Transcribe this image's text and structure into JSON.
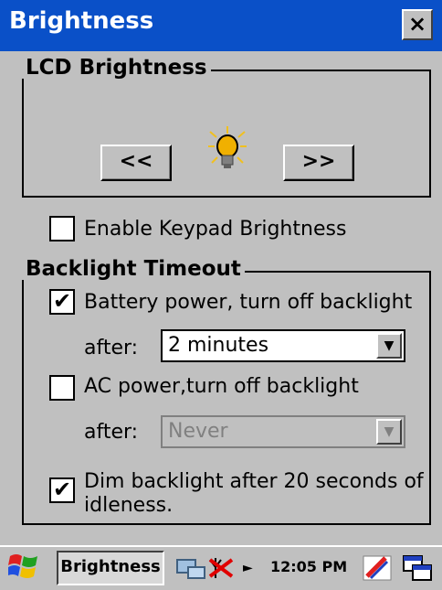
{
  "window": {
    "title": "Brightness",
    "close_label": "×"
  },
  "lcd": {
    "legend": "LCD Brightness",
    "decrease_label": "<<",
    "increase_label": ">>",
    "icon": "lightbulb-icon"
  },
  "keypad": {
    "label": "Enable Keypad Brightness",
    "checked": false
  },
  "backlight": {
    "legend": "Backlight Timeout",
    "battery": {
      "label": "Battery power, turn off backlight",
      "checked": true,
      "after_label": "after:",
      "value": "2 minutes"
    },
    "ac": {
      "label": "AC  power,turn off backlight",
      "checked": false,
      "after_label": "after:",
      "value": "Never"
    },
    "dim": {
      "line1": "Dim backlight after 20 seconds of",
      "line2": "idleness.",
      "checked": true
    }
  },
  "taskbar": {
    "start_icon": "windows-flag-icon",
    "task_label": "Brightness",
    "clock": "12:05 PM",
    "tray_icons": [
      "network-icon",
      "signal-icon",
      "pen-input-icon",
      "desktop-icon"
    ]
  },
  "colors": {
    "titlebar": "#0a50c8",
    "face": "#c0c0c0"
  }
}
